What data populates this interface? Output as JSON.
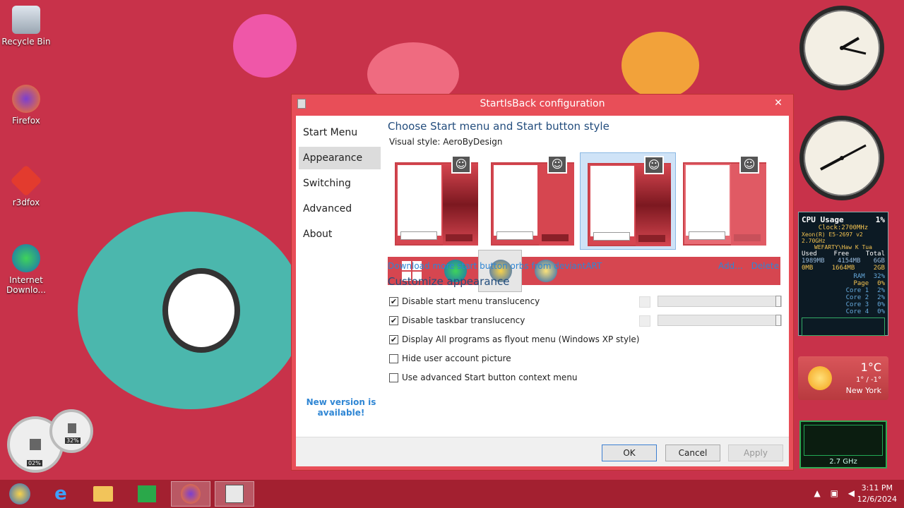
{
  "desktop": {
    "icons": [
      {
        "label": "Recycle Bin"
      },
      {
        "label": "Firefox"
      },
      {
        "label": "r3dfox"
      },
      {
        "label": "Internet Downlo..."
      }
    ]
  },
  "window": {
    "title": "StartIsBack configuration",
    "close_symbol": "✕"
  },
  "sidebar": {
    "items": [
      {
        "label": "Start Menu"
      },
      {
        "label": "Appearance"
      },
      {
        "label": "Switching"
      },
      {
        "label": "Advanced"
      },
      {
        "label": "About"
      }
    ],
    "new_version": "New version is available!"
  },
  "appearance": {
    "heading": "Choose Start menu and Start button style",
    "visual_style_label": "Visual style:",
    "visual_style_value": "AeroByDesign",
    "download_link": "Download more start button orbs from deviantART",
    "add_link": "Add...",
    "delete_link": "Delete",
    "customize_heading": "Customize appearance",
    "options": [
      {
        "label": "Disable start menu translucency",
        "checked": true
      },
      {
        "label": "Disable taskbar translucency",
        "checked": true
      },
      {
        "label": "Display All programs as flyout menu (Windows XP style)",
        "checked": true
      },
      {
        "label": "Hide user account picture",
        "checked": false
      },
      {
        "label": "Use advanced Start button context menu",
        "checked": false
      }
    ]
  },
  "buttons": {
    "ok": "OK",
    "cancel": "Cancel",
    "apply": "Apply"
  },
  "gadgets": {
    "cpu": {
      "title": "CPU Usage",
      "percent": "1%",
      "clock": "Clock:2700MHz",
      "model": "Xeon(R) E5-2697 v2 2.70GHz",
      "host": "WEFARTY\\Haw K Tua",
      "headers": [
        "Used",
        "Free",
        "Total"
      ],
      "row1": [
        "1989MB",
        "4154MB",
        "6GB"
      ],
      "row2": [
        "0MB",
        "1664MB",
        "2GB"
      ],
      "stats": [
        {
          "label": "RAM",
          "value": "32%"
        },
        {
          "label": "Page",
          "value": "0%"
        },
        {
          "label": "Core 1",
          "value": "2%"
        },
        {
          "label": "Core 2",
          "value": "2%"
        },
        {
          "label": "Core 3",
          "value": "0%"
        },
        {
          "label": "Core 4",
          "value": "0%"
        }
      ]
    },
    "weather": {
      "temp": "1°C",
      "range": "1° / -1°",
      "city": "New York"
    },
    "gpu": {
      "freq": "2.7 GHz"
    },
    "meters": {
      "cpu": "02%",
      "ram": "32%"
    }
  },
  "taskbar": {
    "time": "3:11 PM",
    "date": "12/6/2024"
  },
  "colors": {
    "accent": "#e84e58",
    "link": "#2f86d4",
    "heading": "#234d7d"
  }
}
